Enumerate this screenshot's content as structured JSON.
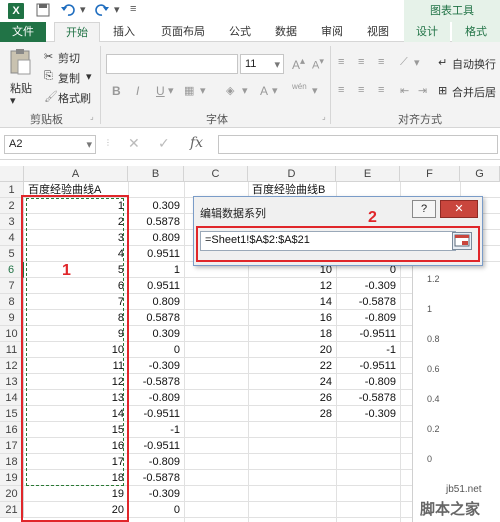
{
  "app": {
    "logo_letter": "X",
    "chart_tools": "图表工具"
  },
  "tabs": [
    "文件",
    "开始",
    "插入",
    "页面布局",
    "公式",
    "数据",
    "审阅",
    "视图",
    "设计",
    "格式"
  ],
  "ribbon": {
    "cut": "剪切",
    "copy": "复制",
    "format_painter": "格式刷",
    "paste": "粘贴",
    "clipboard_group": "剪贴板",
    "font_size": "11",
    "font_group": "字体",
    "bold": "B",
    "italic": "I",
    "underline": "U",
    "wrap_text": "自动换行",
    "merge_center": "合并后居",
    "align_group": "对齐方式",
    "font_color_letter": "A",
    "phonetic": "wén"
  },
  "formula_bar": {
    "name_box": "A2",
    "fx": "fx",
    "cancel": "✕",
    "enter": "✓"
  },
  "sheet": {
    "columns": [
      "A",
      "B",
      "C",
      "D",
      "E",
      "F",
      "G"
    ],
    "rows": [
      "1",
      "2",
      "3",
      "4",
      "5",
      "6",
      "7",
      "8",
      "9",
      "10",
      "11",
      "12",
      "13",
      "14",
      "15",
      "16",
      "17",
      "18",
      "19",
      "20",
      "21"
    ],
    "a1": "百度经验曲线A",
    "d1": "百度经验曲线B",
    "colA": [
      "1",
      "2",
      "3",
      "4",
      "5",
      "6",
      "7",
      "8",
      "9",
      "10",
      "11",
      "12",
      "13",
      "14",
      "15",
      "16",
      "17",
      "18",
      "19",
      "20"
    ],
    "colB": [
      "0.309",
      "0.5878",
      "0.809",
      "0.9511",
      "1",
      "0.9511",
      "0.809",
      "0.5878",
      "0.309",
      "0",
      "-0.309",
      "-0.5878",
      "-0.809",
      "-0.9511",
      "-1",
      "-0.9511",
      "-0.809",
      "-0.5878",
      "-0.309",
      "0"
    ],
    "colD": [
      "10",
      "12",
      "14",
      "16",
      "18",
      "20",
      "22",
      "24",
      "26",
      "28"
    ],
    "colE": [
      "0",
      "-0.309",
      "-0.5878",
      "-0.809",
      "-0.9511",
      "-1",
      "-0.9511",
      "-0.809",
      "-0.5878",
      "-0.309"
    ]
  },
  "dialog": {
    "title": "编辑数据系列",
    "help": "?",
    "close": "✕",
    "series_values": "=Sheet1!$A$2:$A$21"
  },
  "annotations": {
    "label1": "1",
    "label2": "2"
  },
  "chart_fragment": {
    "ticks": [
      "1.2",
      "1",
      "0.8",
      "0.6",
      "0.4",
      "0.2",
      "0"
    ]
  },
  "watermark": {
    "site": "jb51.net",
    "name": "脚本之家"
  }
}
